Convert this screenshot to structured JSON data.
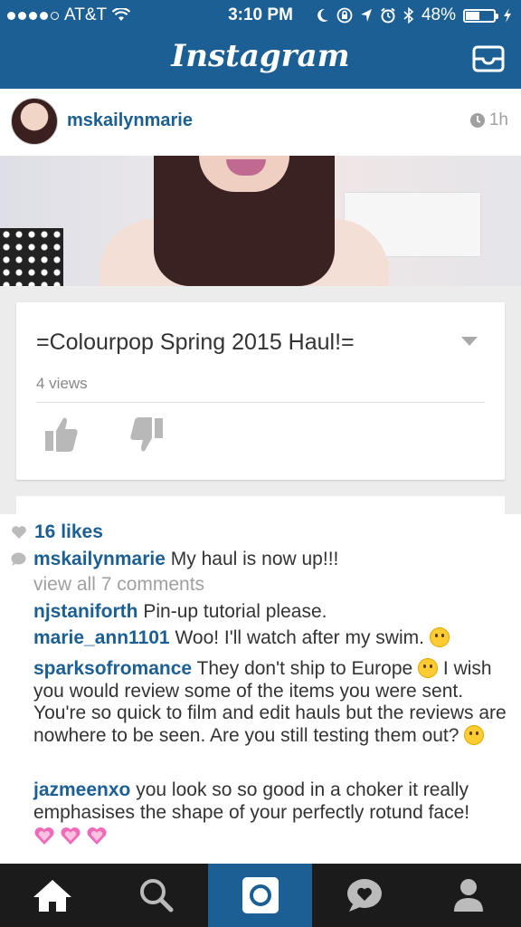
{
  "status_bar": {
    "carrier": "AT&T",
    "time": "3:10 PM",
    "battery_percent": "48%",
    "battery_level": 0.48,
    "signal_dots": [
      true,
      true,
      true,
      true,
      false
    ]
  },
  "nav": {
    "logo": "Instagram",
    "inbox_icon": "inbox-tray-icon"
  },
  "post": {
    "username": "mskailynmarie",
    "time_ago": "1h",
    "video": {
      "title": "=Colourpop Spring 2015 Haul!=",
      "views": "4 views"
    },
    "likes": "16 likes",
    "caption": {
      "user": "mskailynmarie",
      "text": "My haul is now up!!!"
    },
    "view_all": "view all 7 comments",
    "comments": [
      {
        "user": "njstaniforth",
        "text": "Pin-up tutorial please."
      },
      {
        "user": "marie_ann1101",
        "text": "Woo! I'll watch after my swim."
      },
      {
        "user": "sparksofromance",
        "text_a": "They don't ship to Europe",
        "text_b": "I wish you would review some of the items you were sent. You're so quick to film and edit hauls but the reviews are nowhere to be seen. Are you still testing them out?"
      },
      {
        "user": "jazmeenxo",
        "text": "you look so so good in a choker it really emphasises the shape of your perfectly rotund face!"
      }
    ]
  },
  "tabs": [
    "home-icon",
    "search-icon",
    "camera-icon",
    "activity-heart-icon",
    "profile-icon"
  ],
  "colors": {
    "brand_blue": "#1c5f94",
    "tabbar_dark": "#1b1b1b",
    "link_blue": "#1c5f94"
  }
}
